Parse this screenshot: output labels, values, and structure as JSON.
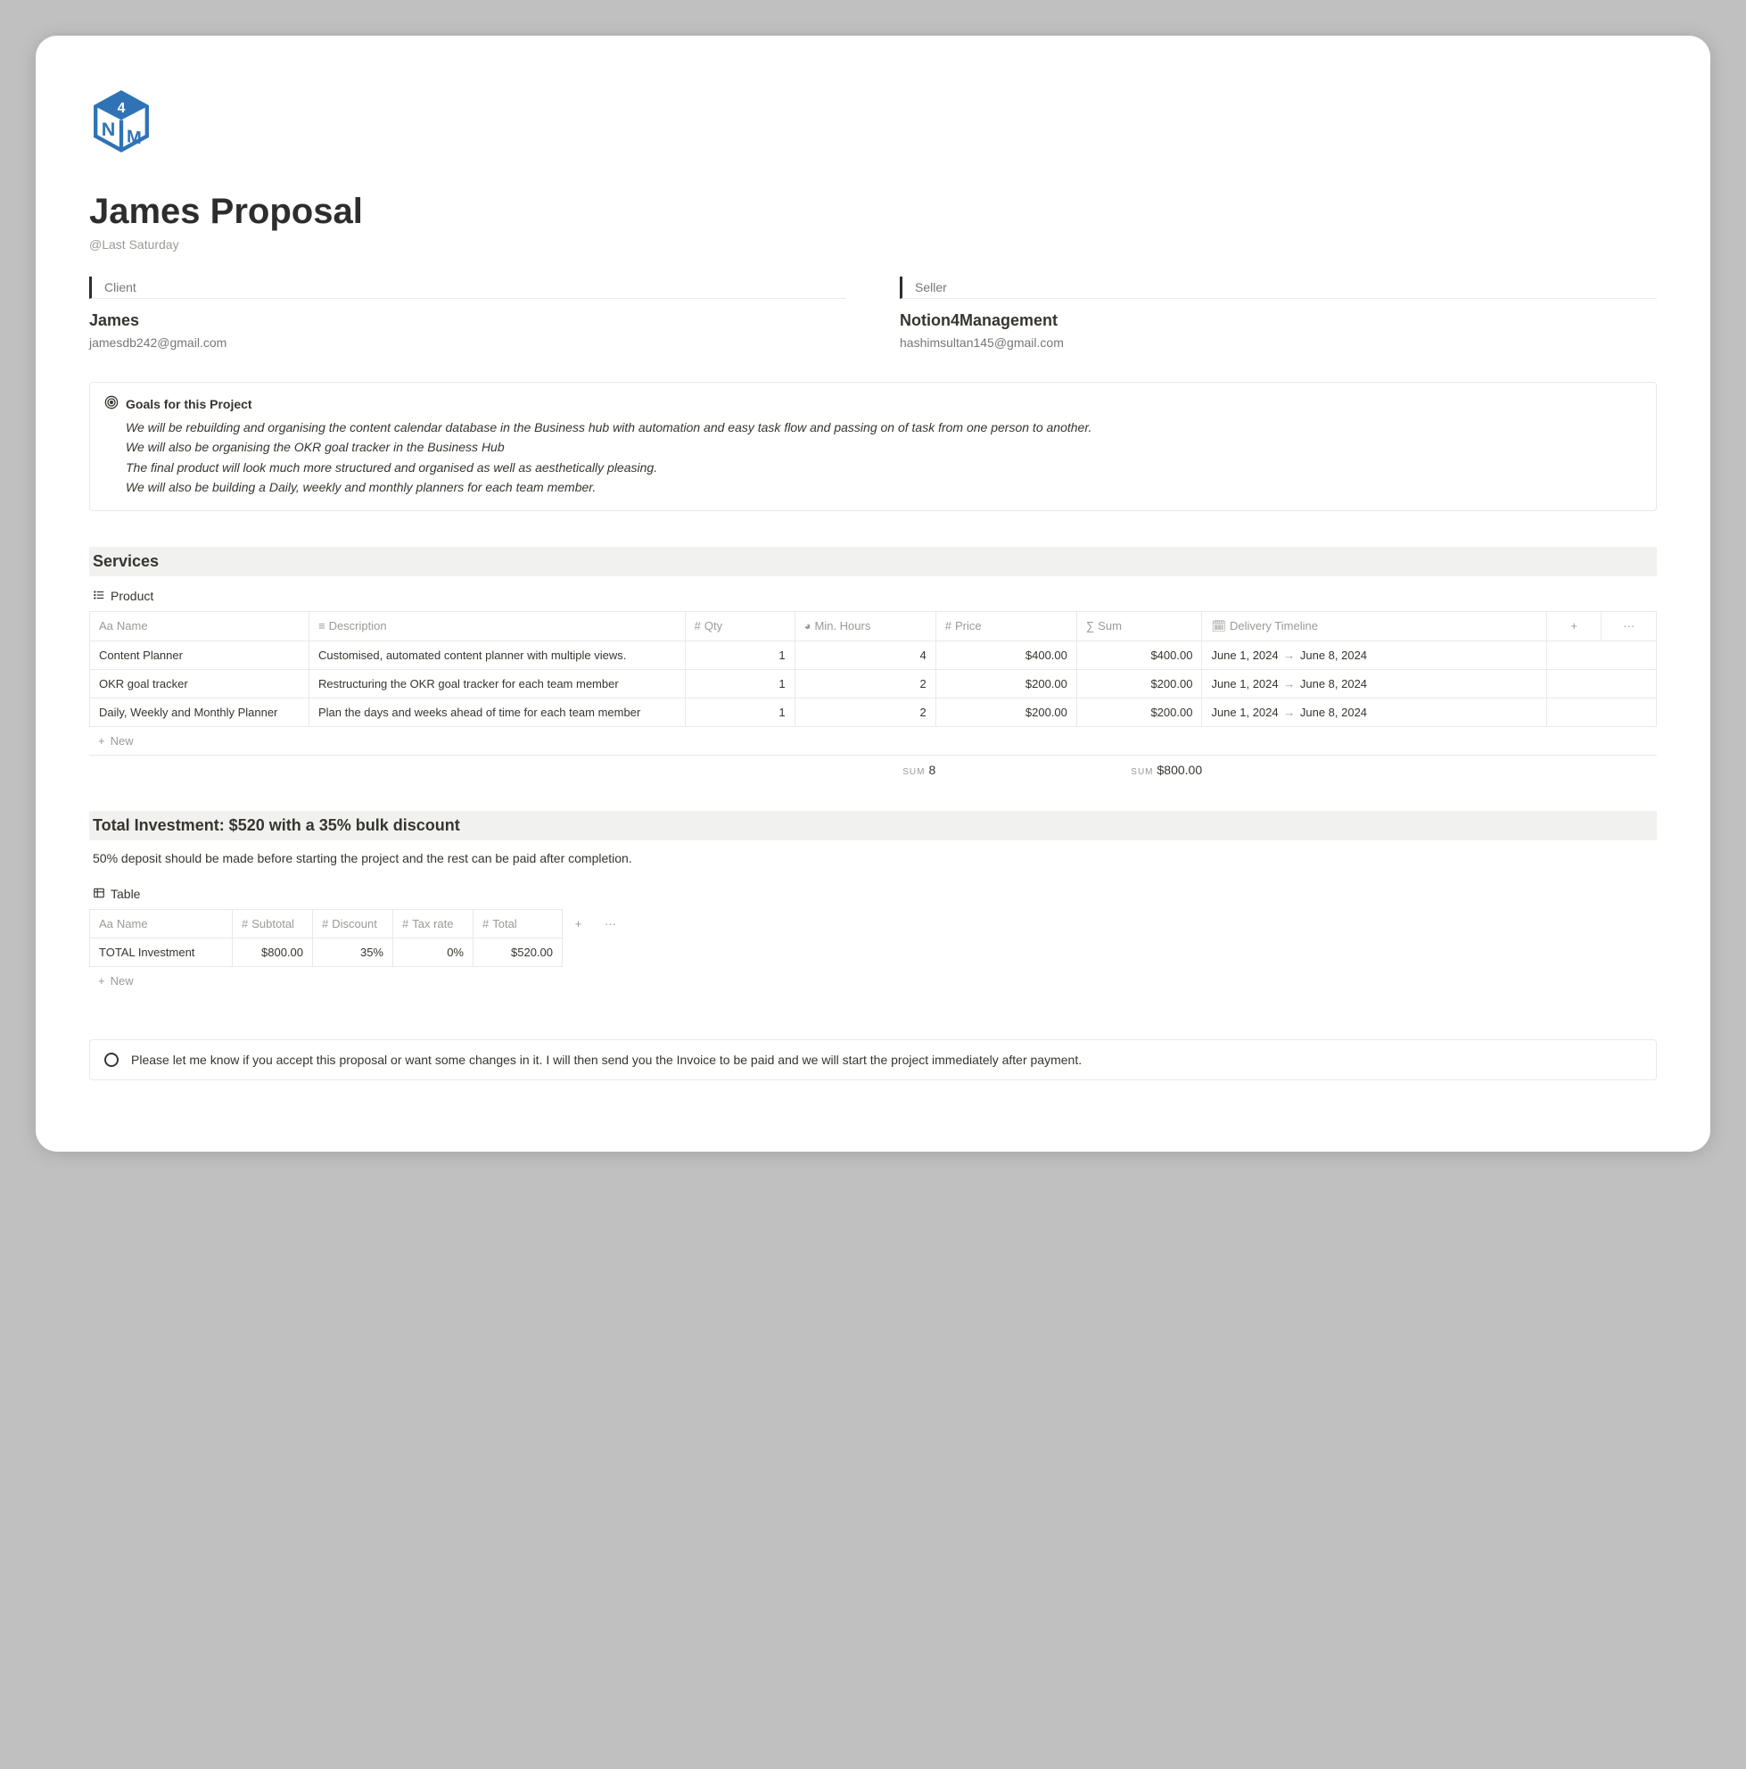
{
  "page": {
    "title": "James Proposal",
    "timestamp": "@Last Saturday"
  },
  "client": {
    "label": "Client",
    "name": "James",
    "email": "jamesdb242@gmail.com"
  },
  "seller": {
    "label": "Seller",
    "name": "Notion4Management",
    "email": "hashimsultan145@gmail.com"
  },
  "goals": {
    "title": "Goals for this Project",
    "lines": [
      "We will be rebuilding and organising the content calendar database in the Business hub with automation and easy task flow and passing on of task from one person to another.",
      "We will also be organising the OKR goal tracker in the Business Hub",
      "The final product will look much more structured and organised as well as aesthetically pleasing.",
      "We will also be building a Daily, weekly and monthly planners for each team member."
    ]
  },
  "services": {
    "heading": "Services",
    "db_title": "Product",
    "columns": {
      "name": "Name",
      "description": "Description",
      "qty": "Qty",
      "min_hours": "Min. Hours",
      "price": "Price",
      "sum": "Sum",
      "delivery": "Delivery Timeline"
    },
    "rows": [
      {
        "name": "Content Planner",
        "description": "Customised, automated content planner with multiple views.",
        "qty": "1",
        "min_hours": "4",
        "price": "$400.00",
        "sum": "$400.00",
        "delivery_from": "June 1, 2024",
        "delivery_to": "June 8, 2024"
      },
      {
        "name": "OKR goal tracker",
        "description": "Restructuring the OKR goal tracker for each team member",
        "qty": "1",
        "min_hours": "2",
        "price": "$200.00",
        "sum": "$200.00",
        "delivery_from": "June 1, 2024",
        "delivery_to": "June 8, 2024"
      },
      {
        "name": "Daily, Weekly and Monthly Planner",
        "description": "Plan the days and weeks ahead of time for each team member",
        "qty": "1",
        "min_hours": "2",
        "price": "$200.00",
        "sum": "$200.00",
        "delivery_from": "June 1, 2024",
        "delivery_to": "June 8, 2024"
      }
    ],
    "new_label": "New",
    "sum_label": "SUM",
    "sum_hours": "8",
    "sum_total": "$800.00"
  },
  "investment": {
    "heading": "Total Investment: $520 with a 35% bulk discount",
    "deposit_note": "50% deposit should be made before starting the project and the rest can be paid after completion.",
    "db_title": "Table",
    "columns": {
      "name": "Name",
      "subtotal": "Subtotal",
      "discount": "Discount",
      "tax_rate": "Tax rate",
      "total": "Total"
    },
    "row": {
      "name": "TOTAL Investment",
      "subtotal": "$800.00",
      "discount": "35%",
      "tax_rate": "0%",
      "total": "$520.00"
    },
    "new_label": "New"
  },
  "closing": {
    "text": "Please let me know if you accept this proposal or want some changes in it. I will then send you the Invoice to be paid and we will start the project immediately after payment."
  }
}
